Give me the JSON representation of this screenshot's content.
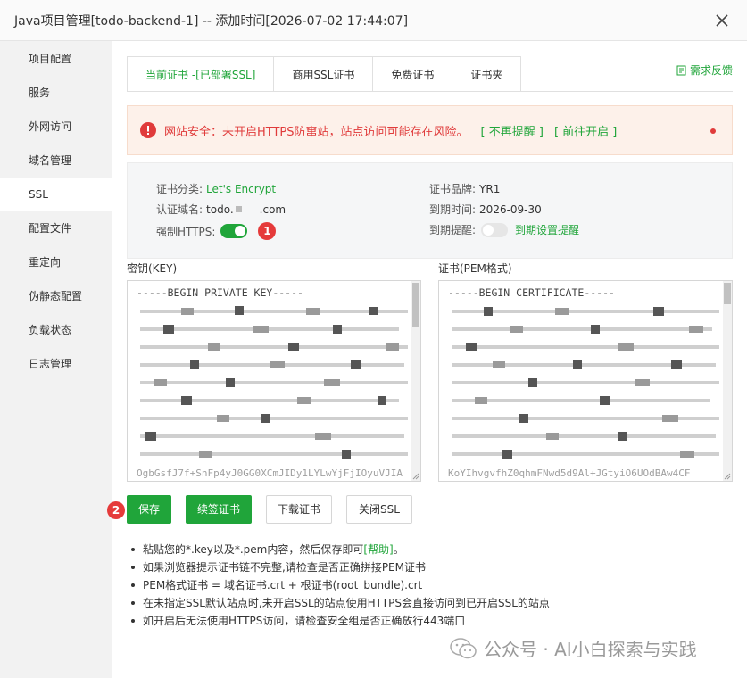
{
  "title": "Java项目管理[todo-backend-1] -- 添加时间[2026-07-02 17:44:07]",
  "sidebar": {
    "items": [
      {
        "label": "项目配置"
      },
      {
        "label": "服务"
      },
      {
        "label": "外网访问"
      },
      {
        "label": "域名管理"
      },
      {
        "label": "SSL"
      },
      {
        "label": "配置文件"
      },
      {
        "label": "重定向"
      },
      {
        "label": "伪静态配置"
      },
      {
        "label": "负载状态"
      },
      {
        "label": "日志管理"
      }
    ],
    "active": "SSL"
  },
  "tabs": [
    {
      "label": "当前证书 -[已部署SSL]"
    },
    {
      "label": "商用SSL证书"
    },
    {
      "label": "免费证书"
    },
    {
      "label": "证书夹"
    }
  ],
  "feedback_label": "需求反馈",
  "alert": {
    "text": "网站安全：未开启HTTPS防窜站，站点访问可能存在风险。",
    "link_dismiss": "[ 不再提醒 ]",
    "link_enable": "[ 前往开启 ]"
  },
  "info": {
    "cert_category_label": "证书分类:",
    "cert_category_value": "Let's Encrypt",
    "domain_label": "认证域名:",
    "domain_value_prefix": "todo.",
    "domain_value_suffix": ".com",
    "force_https_label": "强制HTTPS:",
    "force_https_on": true,
    "brand_label": "证书品牌:",
    "brand_value": "YR1",
    "expire_label": "到期时间:",
    "expire_value": "2026-09-30",
    "reminder_label": "到期提醒:",
    "reminder_on": false,
    "reminder_link": "到期设置提醒"
  },
  "badges": {
    "one": "1",
    "two": "2"
  },
  "key_field": {
    "label": "密钥(KEY)",
    "first_line": "-----BEGIN PRIVATE KEY-----",
    "last_line": "OgbGsfJ7f+SnFp4yJ0GG0XCmJIDy1LYLwYjFjIOyuVJIA"
  },
  "cert_field": {
    "label": "证书(PEM格式)",
    "first_line": "-----BEGIN CERTIFICATE-----",
    "last_line": "KoYIhvgvfhZ0qhmFNwd5d9Al+JGtyiO6UOdBAw4CF"
  },
  "buttons": {
    "save": "保存",
    "renew": "续签证书",
    "download": "下载证书",
    "close_ssl": "关闭SSL"
  },
  "tips": [
    {
      "text": "粘贴您的*.key以及*.pem内容，然后保存即可",
      "link": "[帮助]",
      "after": "。"
    },
    {
      "text": "如果浏览器提示证书链不完整,请检查是否正确拼接PEM证书",
      "link": "",
      "after": ""
    },
    {
      "text": "PEM格式证书 = 域名证书.crt + 根证书(root_bundle).crt",
      "link": "",
      "after": ""
    },
    {
      "text": "在未指定SSL默认站点时,未开启SSL的站点使用HTTPS会直接访问到已开启SSL的站点",
      "link": "",
      "after": ""
    },
    {
      "text": "如开启后无法使用HTTPS访问，请检查安全组是否正确放行443端口",
      "link": "",
      "after": ""
    }
  ],
  "watermark": "公众号 · AI小白探索与实践",
  "colors": {
    "accent": "#20a53a",
    "danger": "#e03b3b",
    "alert_bg": "#fdf1ea"
  }
}
